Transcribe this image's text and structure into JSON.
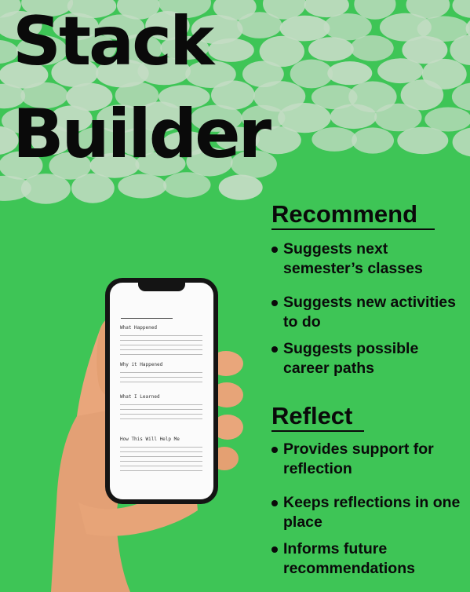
{
  "title": {
    "line1": "Stack",
    "line2": "Builder"
  },
  "sections": {
    "recommend": {
      "heading": "Recommend",
      "bullets": [
        "Suggests next semester’s classes",
        "Suggests new activities to do",
        "Suggests possible career paths"
      ]
    },
    "reflect": {
      "heading": "Reflect",
      "bullets": [
        "Provides support for reflection",
        "Keeps reflections in one place",
        "Informs future recommendations"
      ]
    }
  },
  "phone_screen": {
    "labels": [
      "What Happened",
      "Why it Happened",
      "What I Learned",
      "How This Will Help Me"
    ]
  },
  "colors": {
    "background": "#3ec556",
    "dots": "#c4dcc4",
    "text": "#0a0a0a",
    "skin": "#e9a67b"
  }
}
